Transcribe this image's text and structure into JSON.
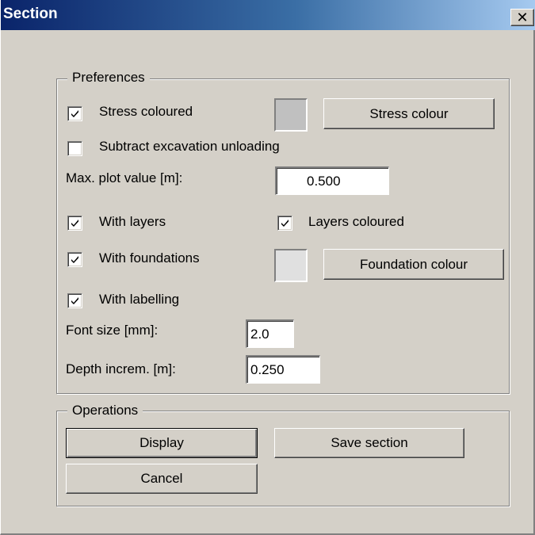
{
  "window": {
    "title": "Section",
    "close_glyph": "✕"
  },
  "preferences": {
    "group_label": "Preferences",
    "stress_coloured": {
      "label": "Stress coloured",
      "checked": true
    },
    "stress_colour_button": "Stress colour",
    "stress_colour_swatch": "#c0c0c0",
    "subtract_excavation": {
      "label": "Subtract excavation unloading",
      "checked": false
    },
    "max_plot_value": {
      "label": "Max. plot value [m]:",
      "value": "0.500"
    },
    "with_layers": {
      "label": "With layers",
      "checked": true
    },
    "layers_coloured": {
      "label": "Layers coloured",
      "checked": true
    },
    "with_foundations": {
      "label": "With foundations",
      "checked": true
    },
    "foundation_colour_button": "Foundation colour",
    "foundation_colour_swatch": "#e0e0e0",
    "with_labelling": {
      "label": "With labelling",
      "checked": true
    },
    "font_size": {
      "label": "Font size [mm]:",
      "value": "2.0"
    },
    "depth_increm": {
      "label": "Depth increm. [m]:",
      "value": "0.250"
    }
  },
  "operations": {
    "group_label": "Operations",
    "display_button": "Display",
    "save_section_button": "Save section",
    "cancel_button": "Cancel"
  },
  "icons": {
    "checkmark": "checkmark-icon",
    "close": "close-icon"
  }
}
